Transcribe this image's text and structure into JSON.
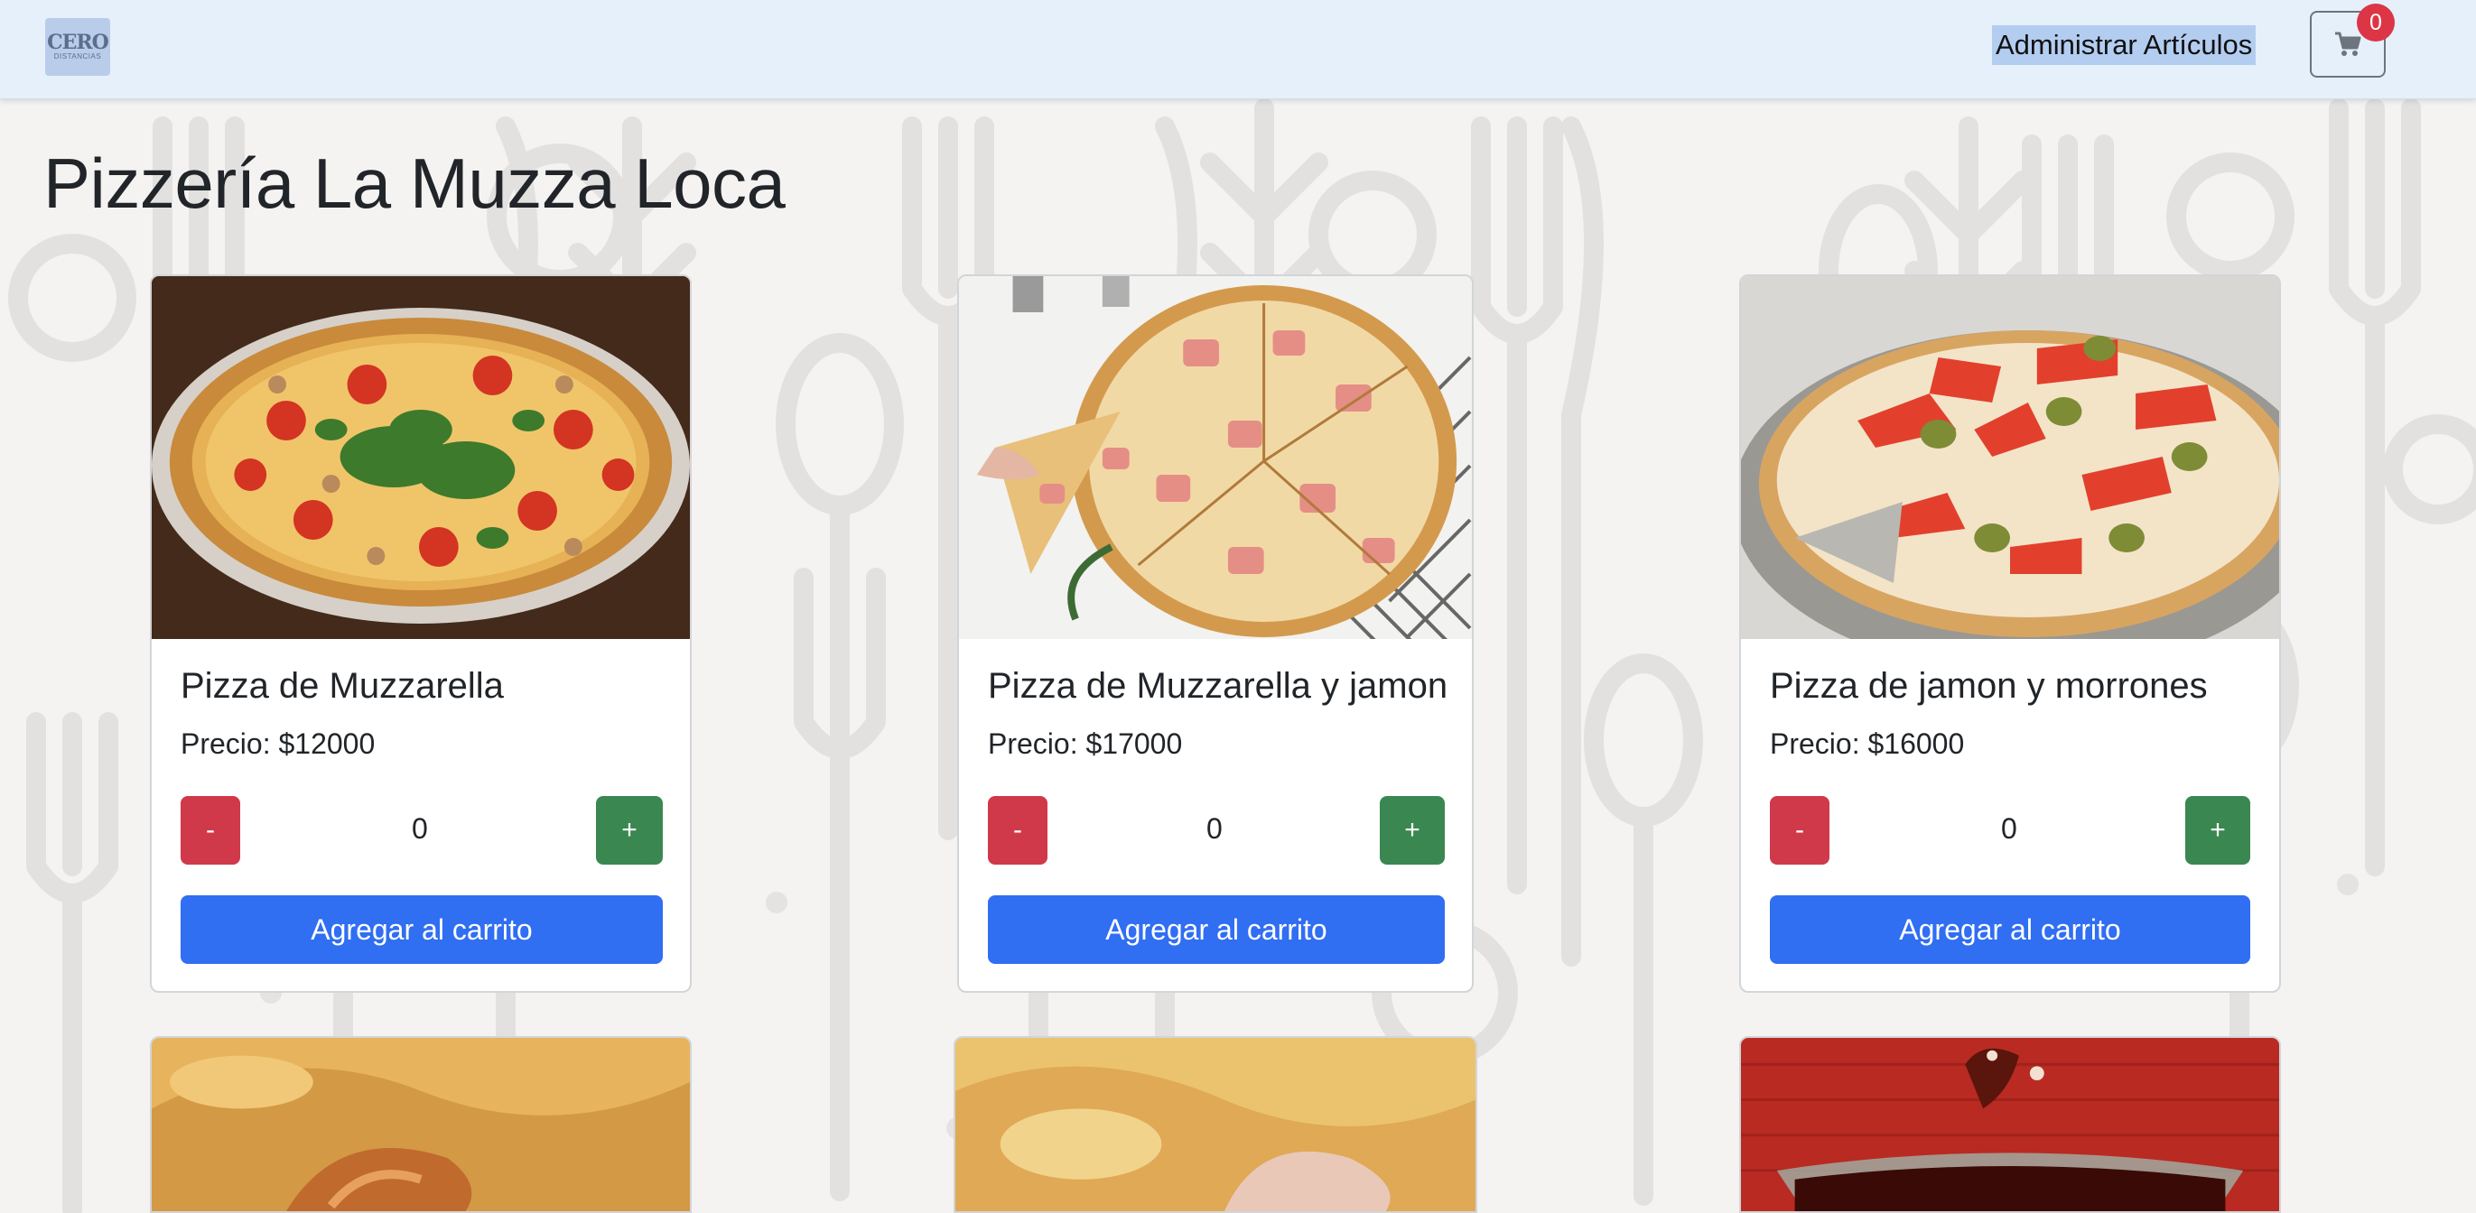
{
  "navbar": {
    "logo_text": "CERO",
    "logo_subtext": "DISTANCIAS",
    "admin_link": "Administrar Artículos",
    "cart_count": "0"
  },
  "page": {
    "title": "Pizzería La Muzza Loca"
  },
  "products": [
    {
      "name": "Pizza de Muzzarella",
      "price": "Precio: $12000",
      "qty": "0",
      "minus": "-",
      "plus": "+",
      "add": "Agregar al carrito"
    },
    {
      "name": "Pizza de Muzzarella y jamon",
      "price": "Precio: $17000",
      "qty": "0",
      "minus": "-",
      "plus": "+",
      "add": "Agregar al carrito"
    },
    {
      "name": "Pizza de jamon y morrones",
      "price": "Precio: $16000",
      "qty": "0",
      "minus": "-",
      "plus": "+",
      "add": "Agregar al carrito"
    }
  ],
  "colors": {
    "primary": "#306ef2",
    "danger": "#d0394a",
    "success": "#3b8752",
    "navbar": "#e6f0fb",
    "badge": "#dc3545"
  },
  "icons": {
    "cart": "cart-icon",
    "logo": "cero-distancias-logo"
  }
}
